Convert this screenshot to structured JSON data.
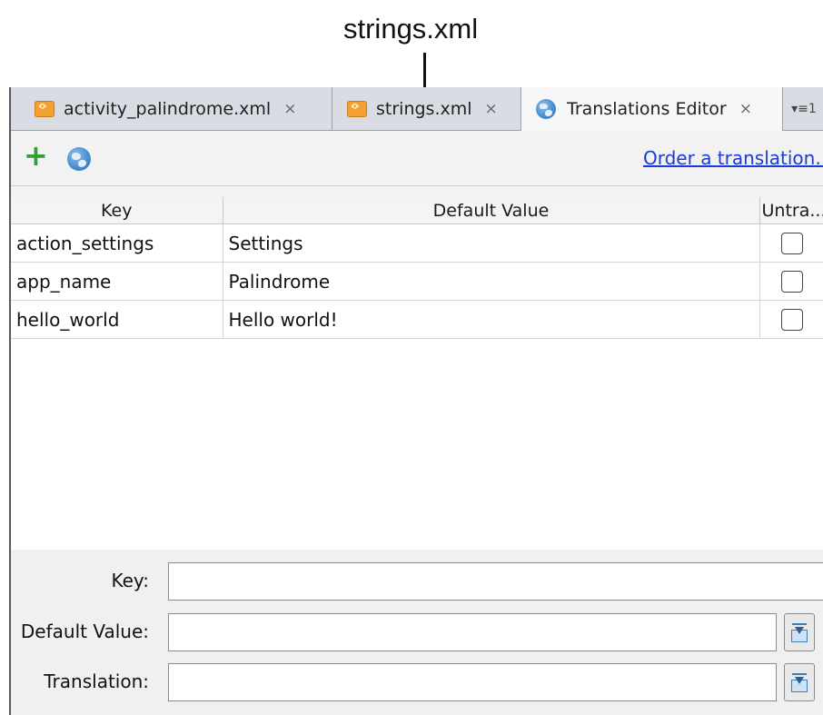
{
  "annotation": {
    "label": "strings.xml"
  },
  "tabs": [
    {
      "label": "activity_palindrome.xml",
      "icon": "xml-file-icon",
      "close": "×"
    },
    {
      "label": "strings.xml",
      "icon": "xml-file-icon",
      "close": "×"
    },
    {
      "label": "Translations Editor",
      "icon": "globe-icon",
      "close": "×",
      "active": true
    }
  ],
  "tab_overflow": {
    "label": "▾≡1"
  },
  "toolbar": {
    "add_icon": "plus-icon",
    "locale_icon": "globe-icon",
    "order_link": "Order a translation..."
  },
  "table": {
    "headers": {
      "key": "Key",
      "default_value": "Default Value",
      "untranslatable": "Untra..."
    },
    "rows": [
      {
        "key": "action_settings",
        "default_value": "Settings",
        "untranslatable": false
      },
      {
        "key": "app_name",
        "default_value": "Palindrome",
        "untranslatable": false
      },
      {
        "key": "hello_world",
        "default_value": "Hello world!",
        "untranslatable": false
      }
    ]
  },
  "form": {
    "key_label": "Key:",
    "key_value": "",
    "default_value_label": "Default Value:",
    "default_value_value": "",
    "translation_label": "Translation:",
    "translation_value": "",
    "browse_icon": "download-icon"
  },
  "colors": {
    "link": "#1a3bd6",
    "add": "#3a9a3a",
    "tab_icon": "#f4a132"
  }
}
